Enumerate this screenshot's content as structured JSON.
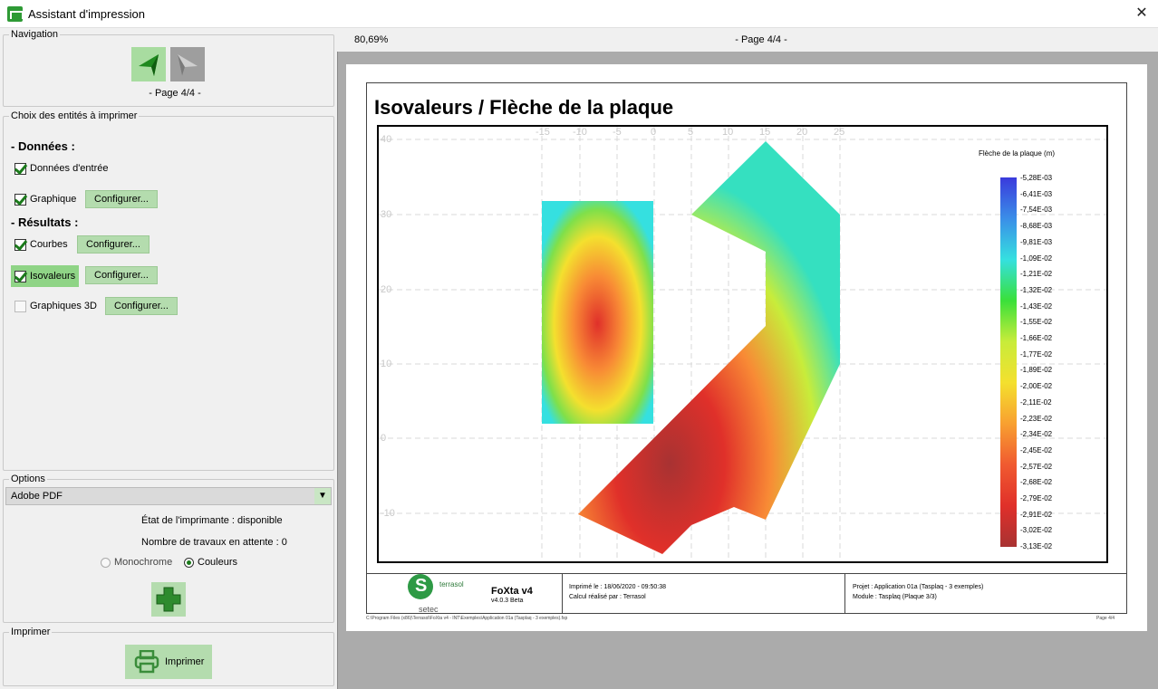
{
  "window": {
    "title": "Assistant d'impression",
    "close": "✕"
  },
  "navigation": {
    "label": "Navigation",
    "page": "- Page 4/4 -",
    "prev_icon": "arrow-left-icon",
    "next_icon": "arrow-right-icon"
  },
  "entities": {
    "label": "Choix des entités à imprimer",
    "donnees_header": "- Données :",
    "resultats_header": "- Résultats :",
    "items": [
      {
        "label": "Données d'entrée",
        "checked": true
      },
      {
        "label": "Graphique",
        "checked": true,
        "config": "Configurer..."
      },
      {
        "label": "Courbes",
        "checked": true,
        "config": "Configurer..."
      },
      {
        "label": "Isovaleurs",
        "checked": true,
        "config": "Configurer...",
        "highlighted": true
      },
      {
        "label": "Graphiques 3D",
        "checked": false,
        "config": "Configurer..."
      }
    ]
  },
  "options": {
    "label": "Options",
    "printer": "Adobe PDF",
    "status": "État de l'imprimante : disponible",
    "jobs": "Nombre de travaux en attente : 0",
    "mono": "Monochrome",
    "color": "Couleurs",
    "selected": "Couleurs",
    "add_icon": "plus-icon"
  },
  "print": {
    "label": "Imprimer",
    "button": "Imprimer",
    "icon": "printer-icon"
  },
  "preview": {
    "zoom": "80,69%",
    "page": "- Page 4/4 -",
    "doc_title": "Isovaleurs / Flèche de la plaque",
    "x_ticks": [
      "-15",
      "-10",
      "-5",
      "0",
      "5",
      "10",
      "15",
      "20",
      "25"
    ],
    "y_ticks": [
      "40",
      "30",
      "20",
      "10",
      "0",
      "-10"
    ],
    "legend_title": "Flèche de la plaque (m)",
    "legend_values": [
      "-5,28E-03",
      "-6,41E-03",
      "-7,54E-03",
      "-8,68E-03",
      "-9,81E-03",
      "-1,09E-02",
      "-1,21E-02",
      "-1,32E-02",
      "-1,43E-02",
      "-1,55E-02",
      "-1,66E-02",
      "-1,77E-02",
      "-1,89E-02",
      "-2,00E-02",
      "-2,11E-02",
      "-2,23E-02",
      "-2,34E-02",
      "-2,45E-02",
      "-2,57E-02",
      "-2,68E-02",
      "-2,79E-02",
      "-2,91E-02",
      "-3,02E-02",
      "-3,13E-02"
    ],
    "footer": {
      "brand_top": "terrasol",
      "brand_bottom": "setec",
      "product": "FoXta v4",
      "version": "v4.0.3 Beta",
      "printed": "Imprimé le : 18/06/2020 - 09:50:38",
      "calc": "Calcul réalisé par : Terrasol",
      "project": "Projet : Application 01a (Tasplaq - 3 exemples)",
      "module": "Module : Tasplaq (Plaque 3/3)",
      "path": "C:\\Program Files (x86)\\Terrasol\\FoXta v4 - INT\\Exemples\\Application 01a (Tasplaq - 3 exemples).fxp",
      "pageno": "Page 4/4"
    }
  },
  "colors": {
    "accent": "#b4dcae",
    "selected": "#8fd486"
  }
}
